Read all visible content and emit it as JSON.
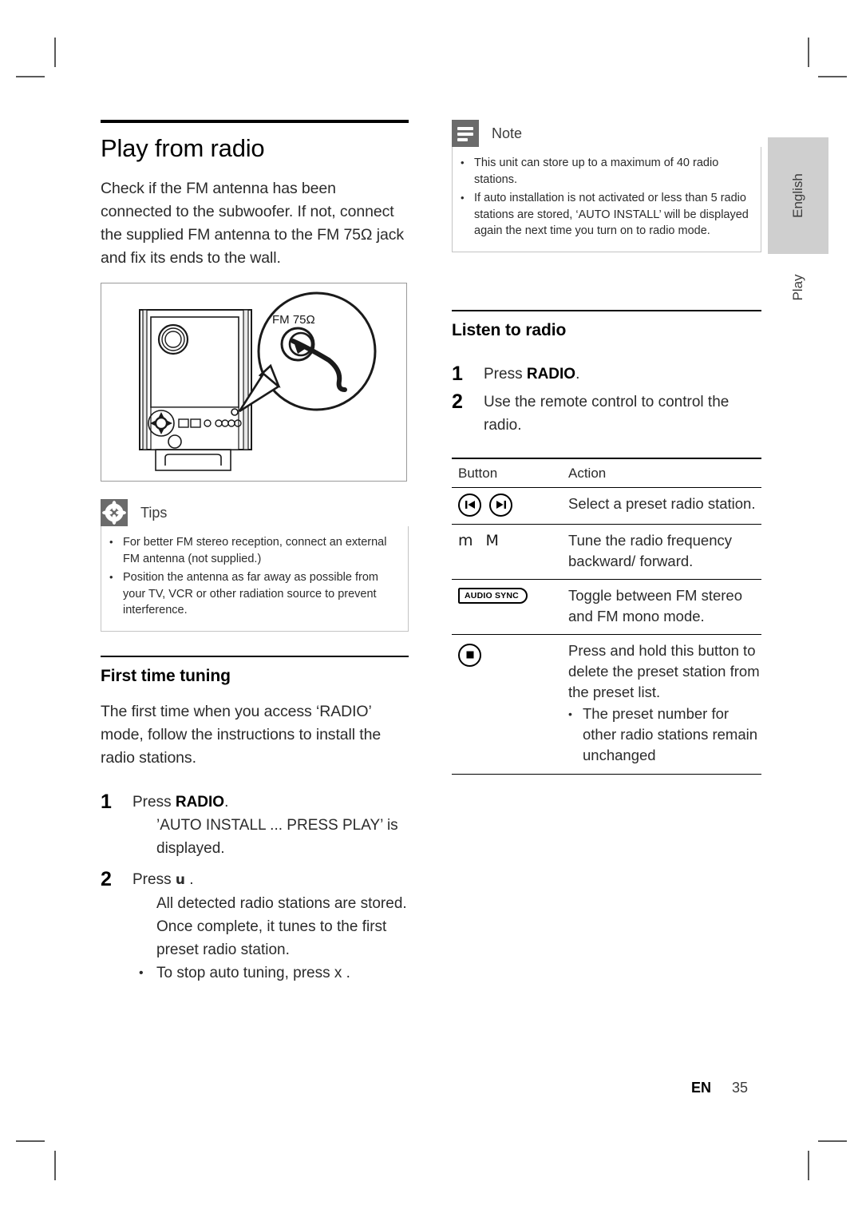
{
  "page": {
    "title": "Play from radio",
    "intro": "Check if the FM antenna has been connected to the subwoofer.  If not, connect the supplied FM antenna to the FM 75Ω jack and fix its ends to the wall.",
    "footer_lang": "EN",
    "footer_page": "35"
  },
  "side_tab": {
    "language": "English",
    "chapter": "Play"
  },
  "figure": {
    "connector_label": "FM 75Ω"
  },
  "tips": {
    "title": "Tips",
    "icon": "asterisk-icon",
    "items": [
      "For better FM stereo reception, connect an external FM antenna (not supplied.)",
      "Position the antenna as far away as possible from your TV, VCR or other radiation source to prevent interference."
    ]
  },
  "note": {
    "title": "Note",
    "icon": "note-lines-icon",
    "items": [
      "This unit can store up to a maximum of 40 radio stations.",
      "If auto installation is not activated or less than 5 radio stations are stored, ‘AUTO INSTALL’ will be displayed again the next time you turn on to radio mode."
    ]
  },
  "first_time_tuning": {
    "heading": "First time tuning",
    "intro": "The first time when you access ‘RADIO’ mode, follow the instructions to install the radio stations.",
    "steps": [
      {
        "num": "1",
        "text_pre": "Press ",
        "text_strong": "RADIO",
        "text_post": ".",
        "sub_lines": [
          "’AUTO INSTALL ... PRESS PLAY’ is displayed."
        ],
        "bullets": []
      },
      {
        "num": "2",
        "text_pre": "Press ",
        "text_strong": "u",
        "text_post": " .",
        "sub_lines": [
          "All detected radio stations are stored.",
          "Once complete, it tunes to the first preset radio station."
        ],
        "bullets": [
          "To stop auto tuning, press x ."
        ]
      }
    ]
  },
  "listen_to_radio": {
    "heading": "Listen to radio",
    "steps": [
      {
        "num": "1",
        "text_pre": "Press ",
        "text_strong": "RADIO",
        "text_post": "."
      },
      {
        "num": "2",
        "text_pre": "Use the remote control to control the radio.",
        "text_strong": "",
        "text_post": ""
      }
    ],
    "table": {
      "headers": {
        "button": "Button",
        "action": "Action"
      },
      "rows": [
        {
          "button_type": "skip-pair",
          "button_label": "",
          "action": "Select a preset radio station.",
          "action_bullets": []
        },
        {
          "button_type": "text",
          "button_label": "m  M",
          "action": "Tune the radio frequency backward/ forward.",
          "action_bullets": []
        },
        {
          "button_type": "audio-sync",
          "button_label": "AUDIO SYNC",
          "action": "Toggle between FM stereo and FM mono mode.",
          "action_bullets": []
        },
        {
          "button_type": "stop",
          "button_label": "",
          "action": "Press and hold this button to delete the preset station from the preset list.",
          "action_bullets": [
            "The preset number for other radio stations remain unchanged"
          ]
        }
      ]
    }
  }
}
